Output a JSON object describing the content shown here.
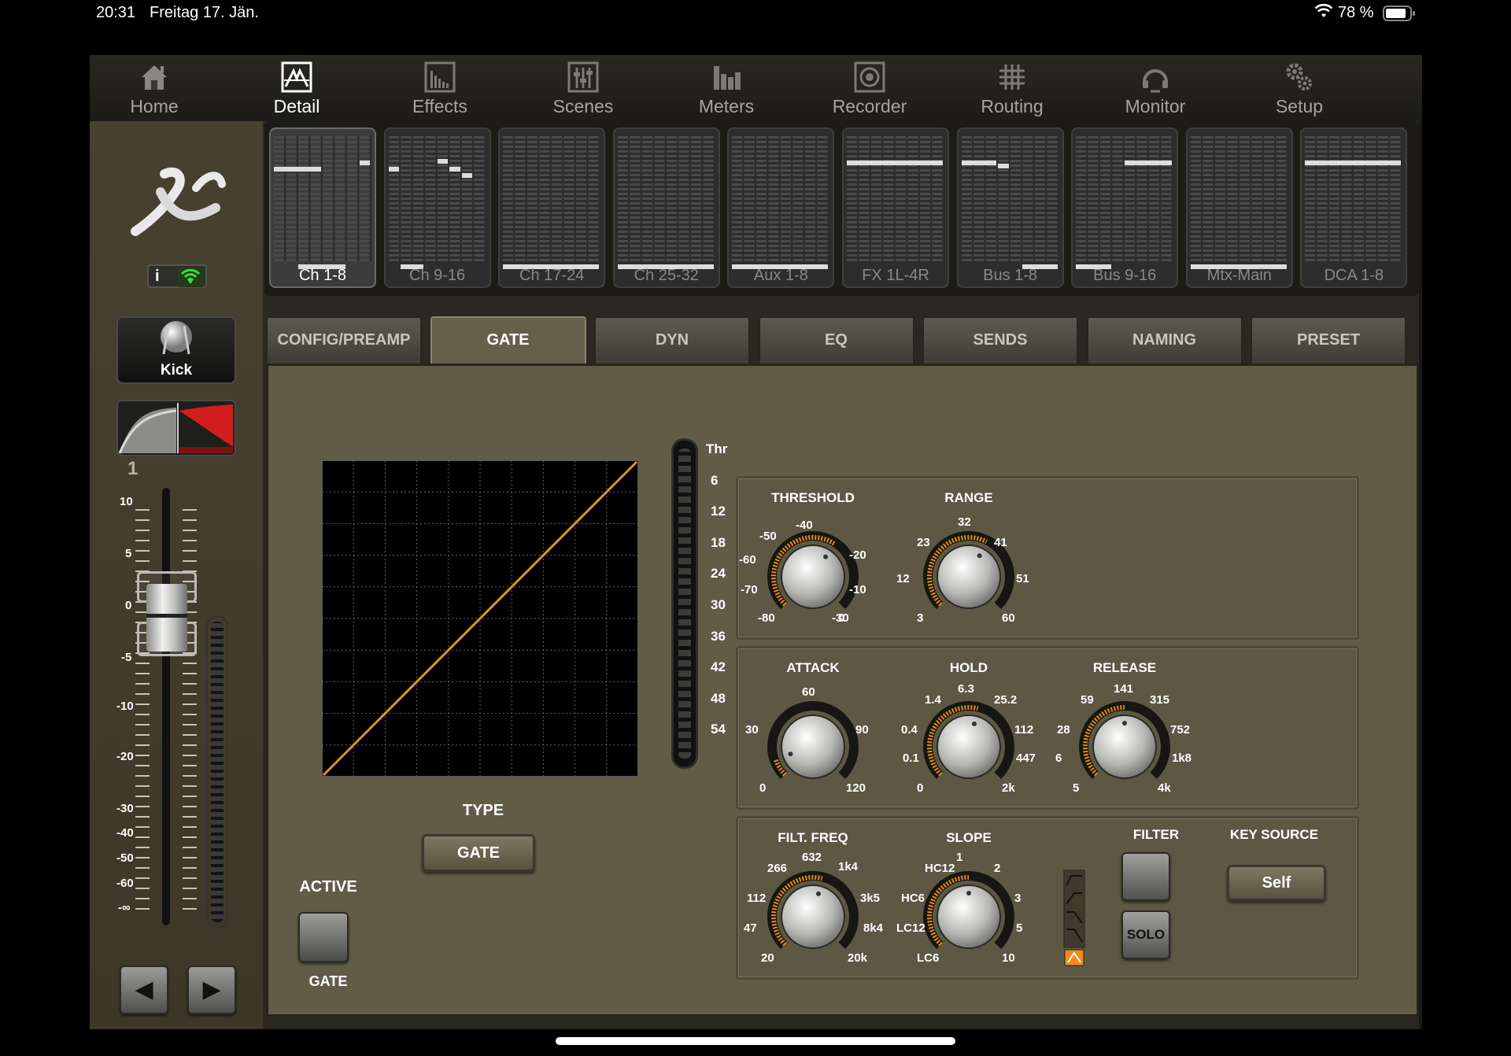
{
  "status_bar": {
    "time": "20:31",
    "date": "Freitag 17. Jän.",
    "battery_percent": "78 %"
  },
  "nav": {
    "items": [
      {
        "label": "Home",
        "icon": "home-icon"
      },
      {
        "label": "Detail",
        "icon": "detail-icon"
      },
      {
        "label": "Effects",
        "icon": "effects-icon"
      },
      {
        "label": "Scenes",
        "icon": "scenes-icon"
      },
      {
        "label": "Meters",
        "icon": "meters-icon"
      },
      {
        "label": "Recorder",
        "icon": "recorder-icon"
      },
      {
        "label": "Routing",
        "icon": "routing-icon"
      },
      {
        "label": "Monitor",
        "icon": "monitor-icon"
      },
      {
        "label": "Setup",
        "icon": "setup-icon"
      }
    ],
    "active": "Detail"
  },
  "channel": {
    "info_label": "i",
    "name": "Kick",
    "number": "1",
    "fader_scale": [
      "10",
      "5",
      "0",
      "-5",
      "-10",
      "-20",
      "-30",
      "-40",
      "-50",
      "-60",
      "-∞"
    ],
    "prev_label": "◀",
    "next_label": "▶"
  },
  "banks": [
    "Ch 1-8",
    "Ch 9-16",
    "Ch 17-24",
    "Ch 25-32",
    "Aux 1-8",
    "FX 1L-4R",
    "Bus 1-8",
    "Bus 9-16",
    "Mtx-Main",
    "DCA 1-8"
  ],
  "active_bank": "Ch 1-8",
  "tabs": [
    "CONFIG/PREAMP",
    "GATE",
    "DYN",
    "EQ",
    "SENDS",
    "NAMING",
    "PRESET"
  ],
  "active_tab": "GATE",
  "gate": {
    "meter_labels": [
      "Thr",
      "6",
      "12",
      "18",
      "24",
      "30",
      "36",
      "42",
      "48",
      "54"
    ],
    "type_label": "TYPE",
    "type_value": "GATE",
    "active_label": "ACTIVE",
    "active_button_label": "GATE",
    "threshold": {
      "label": "THRESHOLD",
      "ticks": [
        "-80",
        "-70",
        "-60",
        "-50",
        "-40",
        "-30",
        "-20",
        "-10",
        "0"
      ]
    },
    "range": {
      "label": "RANGE",
      "ticks": [
        "3",
        "12",
        "23",
        "32",
        "41",
        "51",
        "60"
      ]
    },
    "attack": {
      "label": "ATTACK",
      "ticks": [
        "0",
        "30",
        "60",
        "90",
        "120"
      ]
    },
    "hold": {
      "label": "HOLD",
      "ticks": [
        "0",
        "0.1",
        "0.4",
        "1.4",
        "6.3",
        "25.2",
        "112",
        "447",
        "2k"
      ]
    },
    "release": {
      "label": "RELEASE",
      "ticks": [
        "5",
        "6",
        "28",
        "59",
        "141",
        "315",
        "752",
        "1k8",
        "4k"
      ]
    },
    "filt_freq": {
      "label": "FILT. FREQ",
      "ticks": [
        "20",
        "47",
        "112",
        "266",
        "632",
        "1k4",
        "3k5",
        "8k4",
        "20k"
      ]
    },
    "slope": {
      "label": "SLOPE",
      "ticks": [
        "LC6",
        "LC12",
        "HC6",
        "HC12",
        "1",
        "2",
        "3",
        "5",
        "10"
      ]
    },
    "filter": {
      "label": "FILTER",
      "solo_label": "SOLO"
    },
    "key_source": {
      "label": "KEY SOURCE",
      "value": "Self"
    }
  }
}
